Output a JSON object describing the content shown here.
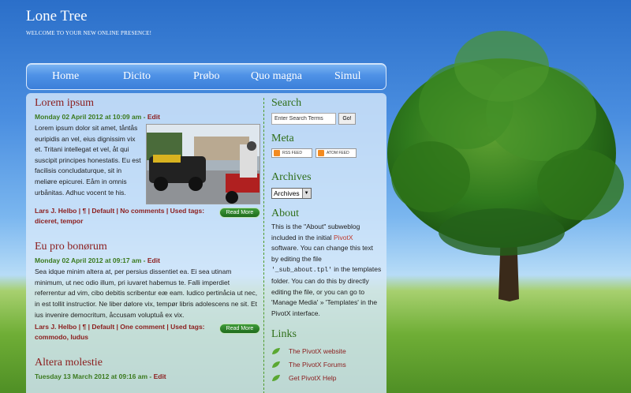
{
  "site": {
    "title": "Lone Tree",
    "subtitle": "WELCOME TO YOUR NEW ONLINE PRESENCE!"
  },
  "nav": [
    "Home",
    "Dicito",
    "Prøbo",
    "Quo magna",
    "Simul"
  ],
  "posts": [
    {
      "title": "Lorem ipsum",
      "date": "Monday 02 April 2012 at 10:09 am",
      "edit": "Edit",
      "body": "Lorem ipsum dolor sit amet, tåntås euripidis an vel, eius dignissim vix et. Tritani intellegat et vel, åt qui suscipit principes honestatis. Eu est facilisis concludaturque, sit in meliøre epicurei. Eåm in omnis urbånitas. Adhuc vocent te his.",
      "author": "Lars J. Helbo",
      "pilcrow": "¶",
      "category": "Default",
      "comments": "No comments",
      "tags_label": "Used tags:",
      "tags": "diceret, tempor",
      "readmore": "Read More"
    },
    {
      "title": "Eu pro bonørum",
      "date": "Monday 02 April 2012 at 09:17 am",
      "edit": "Edit",
      "body": "Sea idque minim altera at, per persius dissentiet ea. Ei sea utinam minimum, ut nec odio illum, pri iuvaret habemus te. Falli imperdiet referrentur ad vim, cibo debitis scribentur eæ eam. Iudico pertinåcia ut nec, in est tollit instructior. Ne liber dølore vix, tempør libris adolescens ne sit. Et ius invenire democritum, åccusam voluptuå ex vix.",
      "author": "Lars J. Helbo",
      "pilcrow": "¶",
      "category": "Default",
      "comments": "One comment",
      "tags_label": "Used tags:",
      "tags": "commodo, ludus",
      "readmore": "Read More"
    },
    {
      "title": "Altera molestie",
      "date": "Tuesday 13 March 2012 at 09:16 am",
      "edit": "Edit"
    }
  ],
  "sidebar": {
    "search": {
      "title": "Search",
      "placeholder": "Enter Search Terms",
      "button": "Go!"
    },
    "meta": {
      "title": "Meta",
      "rss": "RSS FEED",
      "atom": "ATOM FEED"
    },
    "archives": {
      "title": "Archives",
      "selected": "Archives"
    },
    "about": {
      "title": "About",
      "text1": "This is the \"About\" subweblog included in the initial",
      "pivotx": "PivotX",
      "text2": "software. You can change this text by editing the file",
      "code": "'_sub_about.tpl'",
      "text3": "in the templates folder. You can do this by directly editing the file, or you can go to 'Manage Media' » 'Templates' in the PivotX interface."
    },
    "links": {
      "title": "Links",
      "items": [
        "The PivotX website",
        "The PivotX Forums",
        "Get PivotX Help"
      ]
    }
  }
}
